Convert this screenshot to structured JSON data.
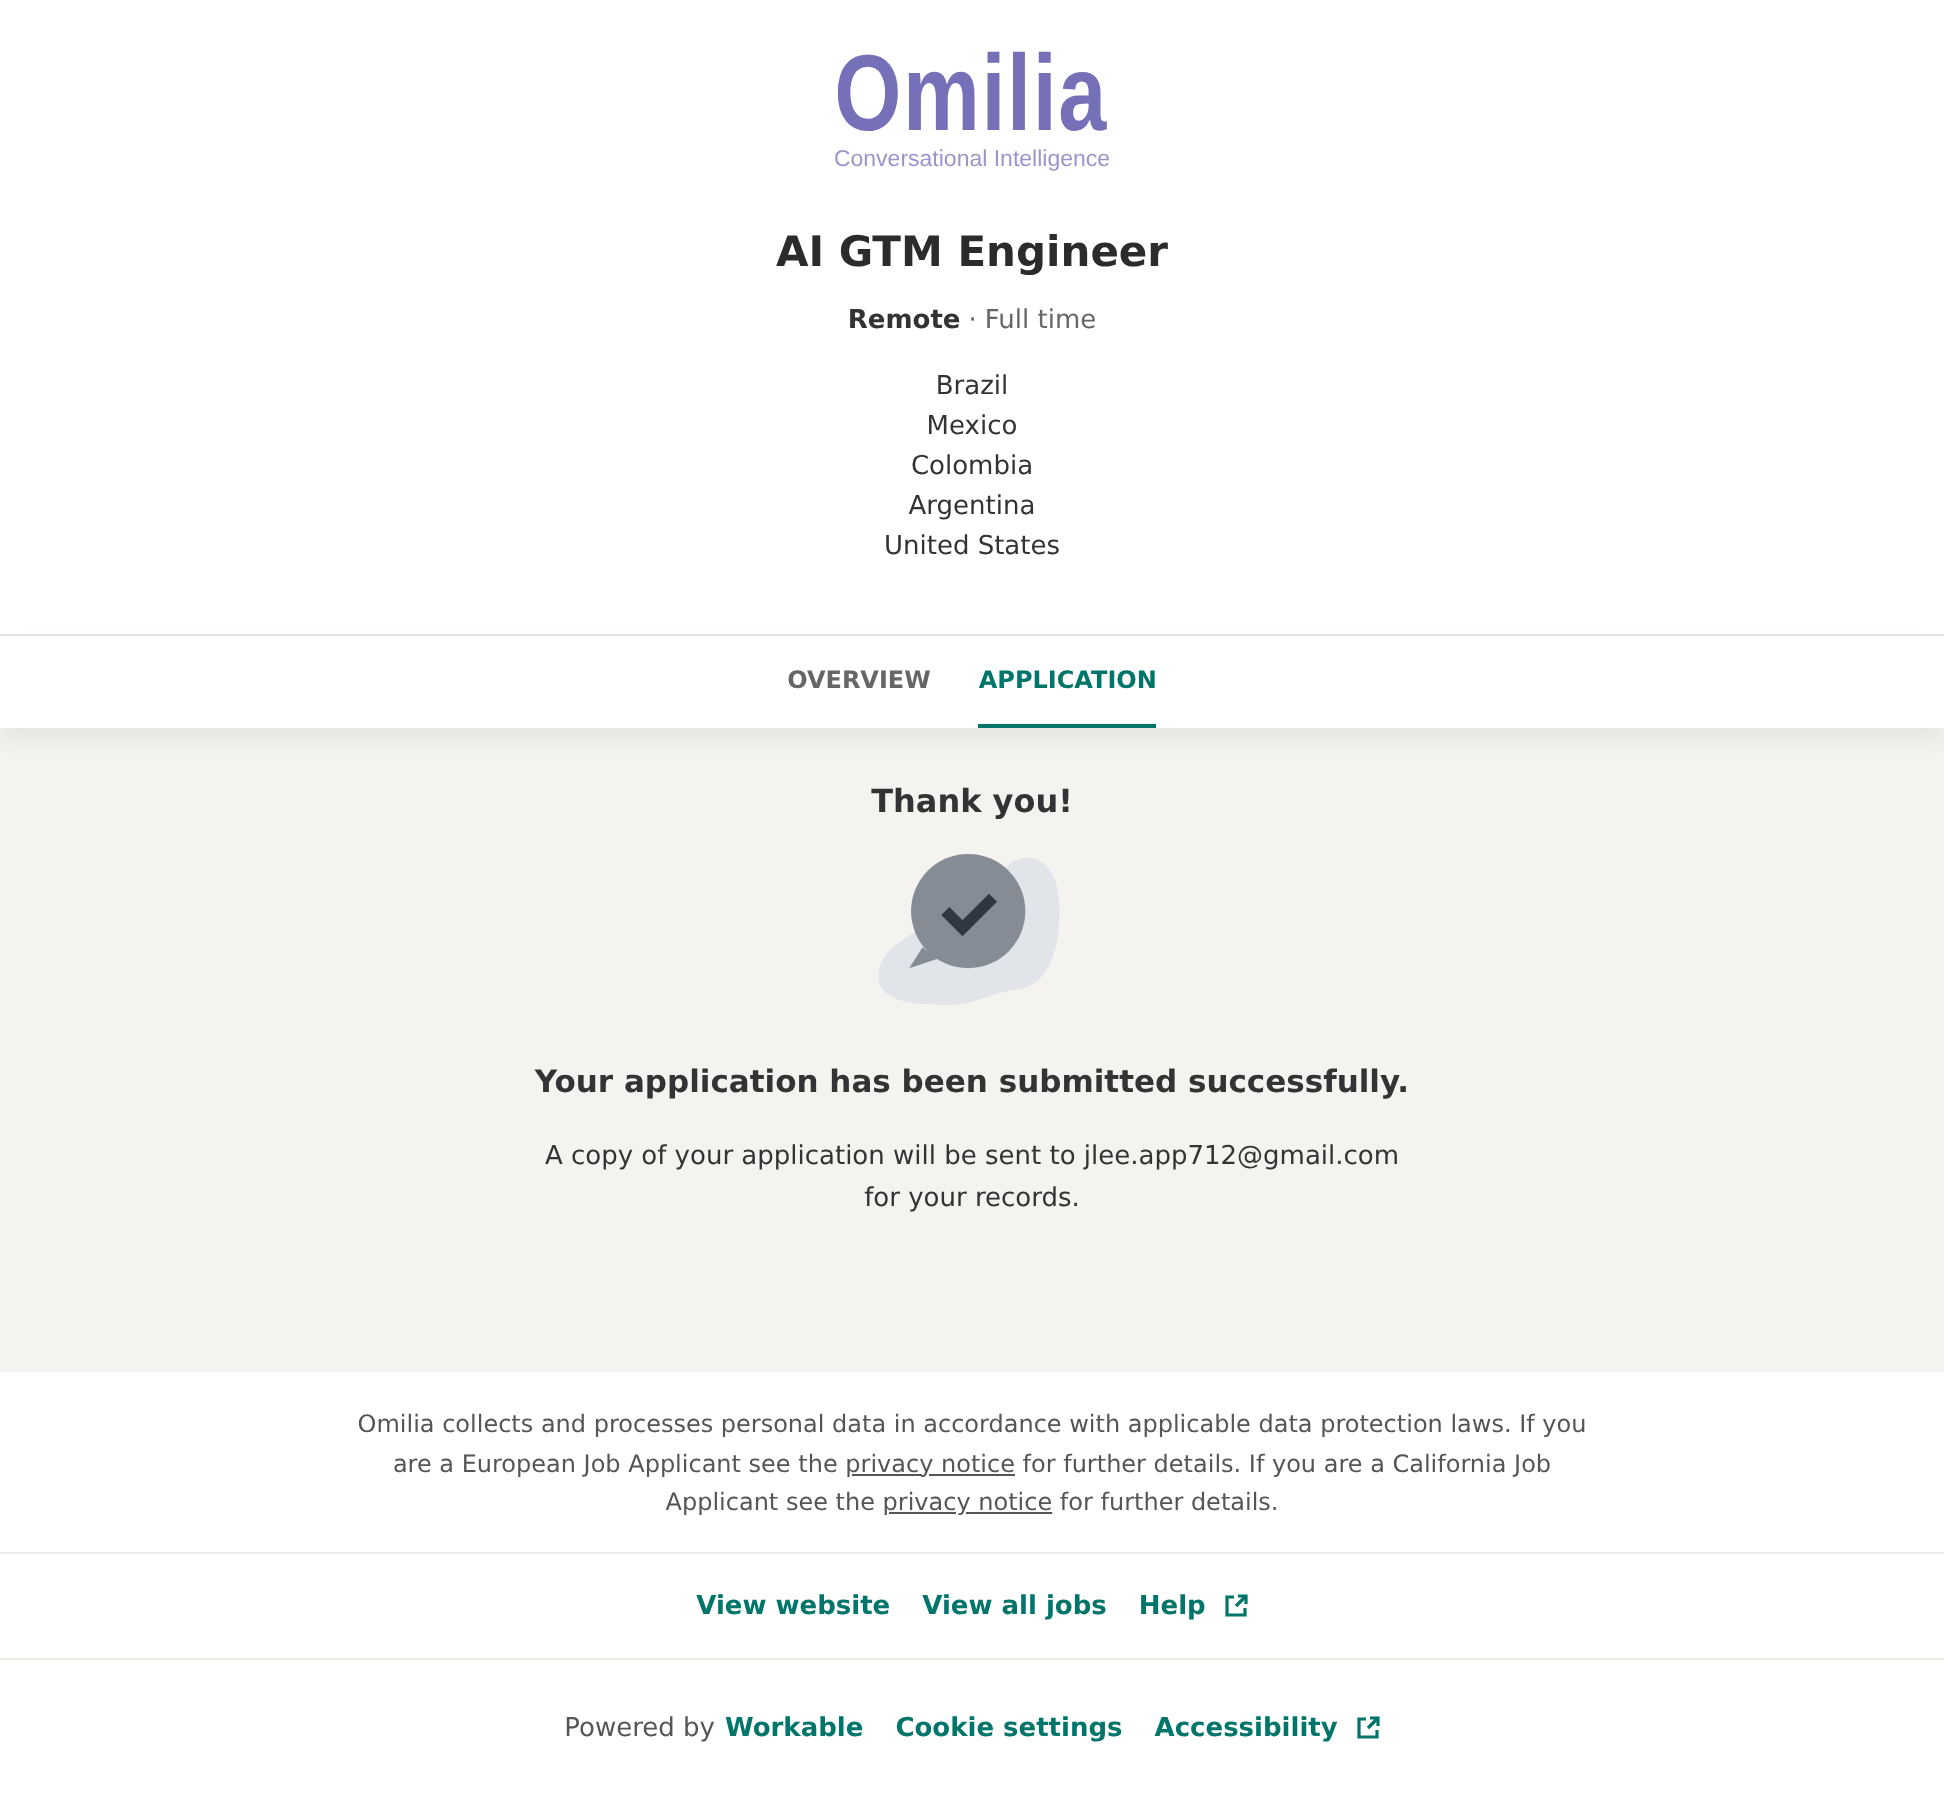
{
  "logo": {
    "name": "Omilia",
    "tagline": "Conversational Intelligence"
  },
  "job": {
    "title": "AI GTM Engineer",
    "workplace": "Remote",
    "separator": "·",
    "type": "Full time",
    "locations": [
      "Brazil",
      "Mexico",
      "Colombia",
      "Argentina",
      "United States"
    ]
  },
  "tabs": [
    {
      "label": "OVERVIEW",
      "selected": false
    },
    {
      "label": "APPLICATION",
      "selected": true
    }
  ],
  "confirmation": {
    "heading": "Thank you!",
    "message": "Your application has been submitted successfully.",
    "note": "A copy of your application will be sent to jlee.app712@gmail.com for your records."
  },
  "notice": [
    {
      "kind": "text",
      "text": "Omilia collects and processes personal data in accordance with applicable data protection laws. If you are a European Job Applicant see the "
    },
    {
      "kind": "link",
      "text": "privacy notice"
    },
    {
      "kind": "text",
      "text": " for further details. If you are a California Job Applicant see the "
    },
    {
      "kind": "link",
      "text": "privacy notice"
    },
    {
      "kind": "text",
      "text": " for further details."
    }
  ],
  "links": [
    {
      "label": "View website",
      "external": false
    },
    {
      "label": "View all jobs",
      "external": false
    },
    {
      "label": "Help",
      "external": true
    }
  ],
  "footer": {
    "powered_by": "Powered by",
    "brand": "Workable",
    "links": [
      {
        "label": "Cookie settings",
        "external": false
      },
      {
        "label": "Accessibility",
        "external": true
      }
    ]
  }
}
